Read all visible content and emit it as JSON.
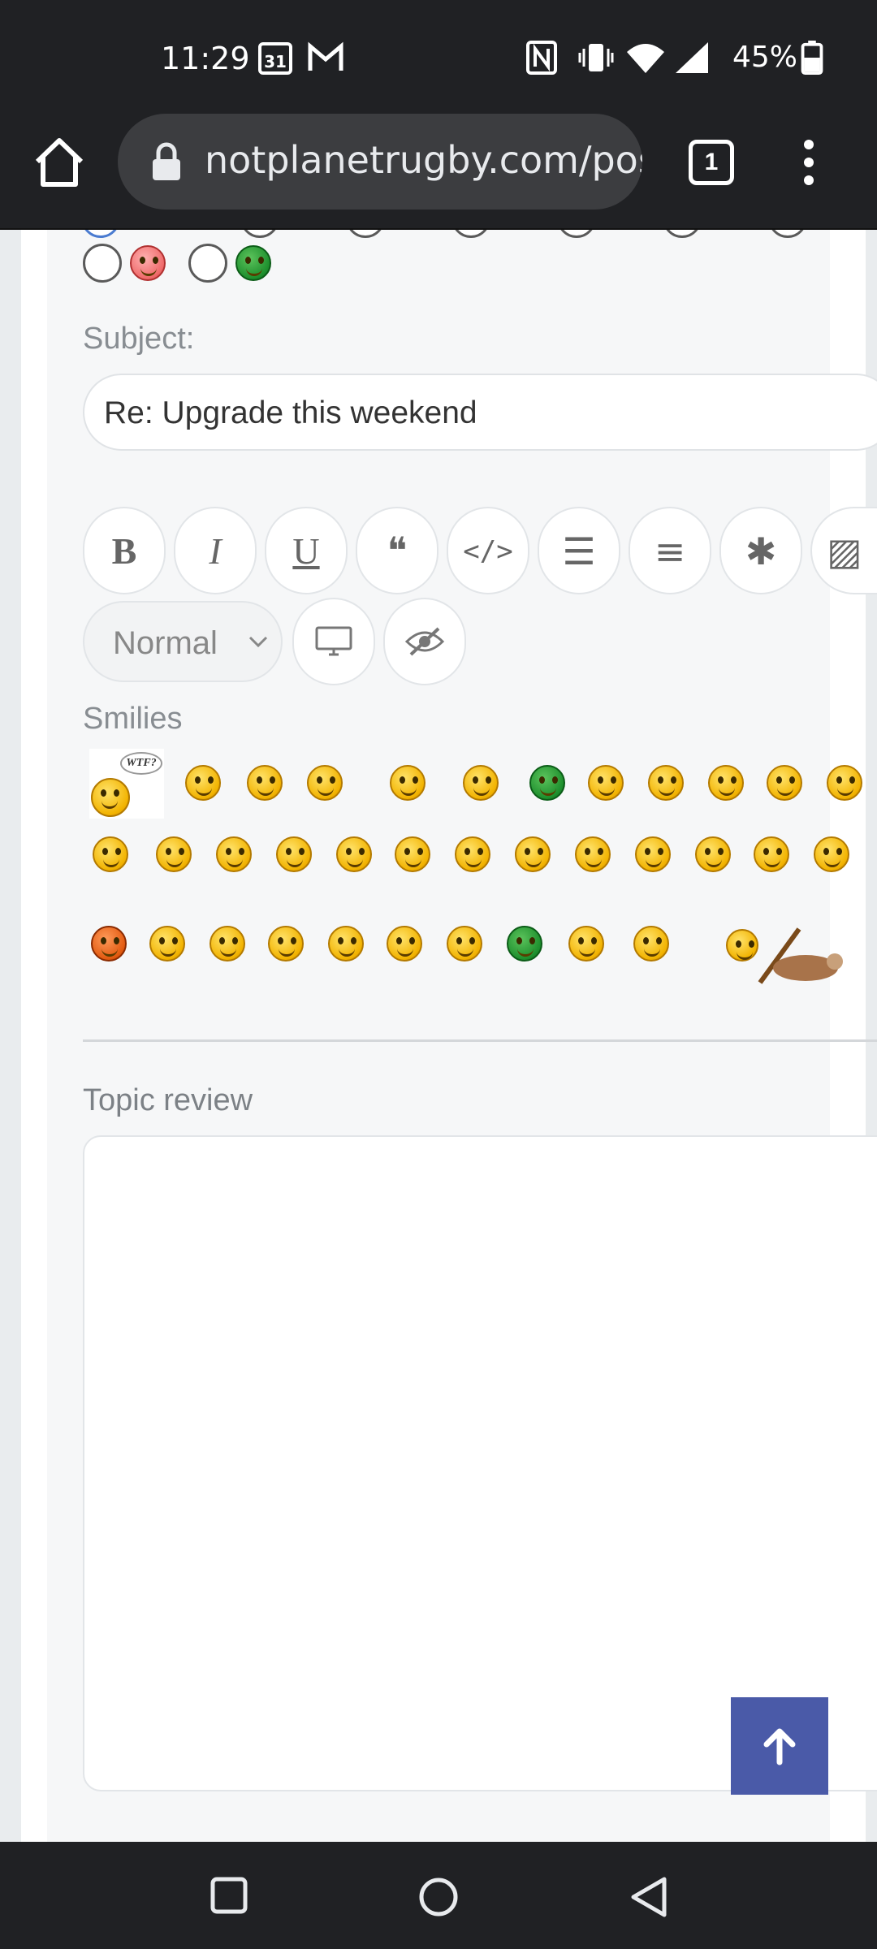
{
  "status_bar": {
    "time": "11:29",
    "calendar_day": "31",
    "battery": "45%",
    "icons": [
      "calendar-icon",
      "gmail-icon",
      "nfc-icon",
      "vibrate-icon",
      "wifi-icon",
      "signal-icon",
      "battery-icon"
    ]
  },
  "browser": {
    "url": "notplanetrugby.com/pos",
    "tab_count": "1"
  },
  "form": {
    "subject_label": "Subject:",
    "subject_value": "Re: Upgrade this weekend",
    "format_select": "Normal",
    "smilies_label": "Smilies",
    "wtf_bubble": "WTF?",
    "topic_review_label": "Topic review",
    "toolbar": [
      {
        "name": "bold",
        "glyph": "B"
      },
      {
        "name": "italic",
        "glyph": "I"
      },
      {
        "name": "underline",
        "glyph": "U"
      },
      {
        "name": "quote",
        "glyph": "❝"
      },
      {
        "name": "code",
        "glyph": "</>"
      },
      {
        "name": "list",
        "glyph": "☰"
      },
      {
        "name": "ordered-list",
        "glyph": "≡"
      },
      {
        "name": "list-item",
        "glyph": "✱"
      },
      {
        "name": "image",
        "glyph": "▨"
      }
    ]
  },
  "colors": {
    "status_bg": "#202124",
    "card_bg": "#f6f7f8",
    "label": "#888d92",
    "back_to_top": "#4a5aa8"
  }
}
